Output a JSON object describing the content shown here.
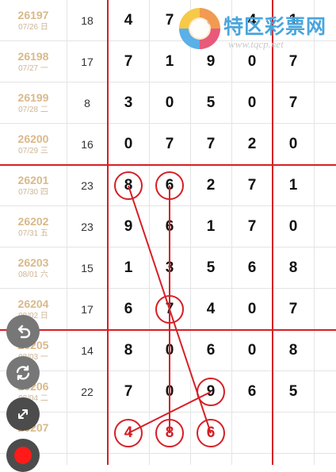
{
  "table": {
    "rows": [
      {
        "issue": "26197",
        "date": "07/26 日",
        "sum": "18",
        "digits": [
          "4",
          "7",
          "3",
          "4",
          "1"
        ]
      },
      {
        "issue": "26198",
        "date": "07/27 一",
        "sum": "17",
        "digits": [
          "7",
          "1",
          "9",
          "0",
          "7"
        ]
      },
      {
        "issue": "26199",
        "date": "07/28 二",
        "sum": "8",
        "digits": [
          "3",
          "0",
          "5",
          "0",
          "7"
        ]
      },
      {
        "issue": "26200",
        "date": "07/29 三",
        "sum": "16",
        "digits": [
          "0",
          "7",
          "7",
          "2",
          "0"
        ]
      },
      {
        "issue": "26201",
        "date": "07/30 四",
        "sum": "23",
        "digits": [
          "8",
          "6",
          "2",
          "7",
          "1"
        ]
      },
      {
        "issue": "26202",
        "date": "07/31 五",
        "sum": "23",
        "digits": [
          "9",
          "6",
          "1",
          "7",
          "0"
        ]
      },
      {
        "issue": "26203",
        "date": "08/01 六",
        "sum": "15",
        "digits": [
          "1",
          "3",
          "5",
          "6",
          "8"
        ]
      },
      {
        "issue": "26204",
        "date": "08/02 日",
        "sum": "17",
        "digits": [
          "6",
          "7",
          "4",
          "0",
          "7"
        ]
      },
      {
        "issue": "26205",
        "date": "08/03 一",
        "sum": "14",
        "digits": [
          "8",
          "0",
          "6",
          "0",
          "8"
        ]
      },
      {
        "issue": "26206",
        "date": "08/04 二",
        "sum": "22",
        "digits": [
          "7",
          "0",
          "9",
          "6",
          "5"
        ]
      },
      {
        "issue": "26207",
        "date": "",
        "sum": "",
        "digits": [
          "4",
          "8",
          "6",
          "",
          ""
        ]
      }
    ]
  },
  "watermark": {
    "title": "特区彩票网",
    "url": "www.tqcp.net"
  },
  "toolbar": {
    "buttons": [
      {
        "name": "undo-button",
        "icon": "undo-icon"
      },
      {
        "name": "refresh-button",
        "icon": "refresh-icon"
      },
      {
        "name": "expand-button",
        "icon": "expand-icon"
      },
      {
        "name": "record-button",
        "icon": "record-icon"
      }
    ]
  },
  "colors": {
    "accent_red": "#d61f25",
    "issue_gold": "#d9b98a",
    "watermark_blue": "#49a5dd",
    "fab_gray": "#4c4c4c"
  }
}
